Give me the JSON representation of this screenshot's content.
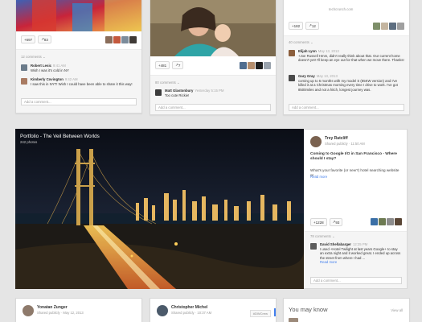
{
  "card1": {
    "plus_count": "+697",
    "share_count": "83",
    "comments_label": "12 comments",
    "comment1": {
      "name": "Robert Lesic",
      "time": "9:41 AM",
      "text": "Wish I was it's cold in NY"
    },
    "comment2": {
      "name": "Kimberly Covington",
      "time": "9:42 AM",
      "text": "I saw this in NYT! Wish I could have been able to share it this way!"
    },
    "add_comment": "Add a comment..."
  },
  "card2": {
    "plus_count": "+481",
    "share_count": "7",
    "comments_label": "80 comments",
    "comment1": {
      "name": "Matt Glastonbury",
      "time": "Yesterday 5:15 PM",
      "text": "Too cute Rickie!"
    },
    "add_comment": "Add a comment..."
  },
  "card3": {
    "top_text": "techcrunch.com",
    "plus_count": "+182",
    "share_count": "12",
    "comments_label": "40 comments",
    "comment1": {
      "name": "Elijah Lynn",
      "time": "May 13, 2013",
      "text": "+Joe Russell Hmm, didn't really think about that. Our current home doesn't yet! I'll keep an eye out for that when we move there. Thanks!"
    },
    "comment2": {
      "name": "Gary Gray",
      "time": "May 13, 2013",
      "text": "coming up to 6 months with my model S (85KW version) and I've killed it at a Christmas morning every time I drive to work. I've got 8500miles and not a hitch, longest journey was."
    },
    "add_comment": "Add a comment..."
  },
  "feature": {
    "photo_title": "Portfolio - The Veil Between Worlds",
    "photo_count": "242 photos",
    "author": "Trey Ratcliff",
    "shared": "Shared publicly",
    "time": "11:50 AM",
    "body": "Coming to Google I/O in San Francisco - Where should I stay?",
    "body2": "What's your favorite (or new?) hotel searching website or ...",
    "read_more": "Read more",
    "plus_count": "+1228",
    "share_count": "93",
    "comments_label": "78 comments",
    "comment1": {
      "name": "David Shellabarger",
      "time": "12:25 PM",
      "text": "I used +Hotel Twilight at last years Google+ to stay an extra night and it worked great. I ended up across the street from where I had ..."
    },
    "comment_read_more": "Read more",
    "add_comment": "Add a comment..."
  },
  "bottom": {
    "post1": {
      "name": "Yonatan Zunger",
      "shared": "Shared publicly",
      "time": "May 12, 2013"
    },
    "post2": {
      "name": "Christopher Michel",
      "shared": "Shared publicly",
      "time": "10:37 AM",
      "tag": "#DWCrew"
    },
    "mayknow": {
      "title": "You may know",
      "view_all": "View all"
    }
  }
}
